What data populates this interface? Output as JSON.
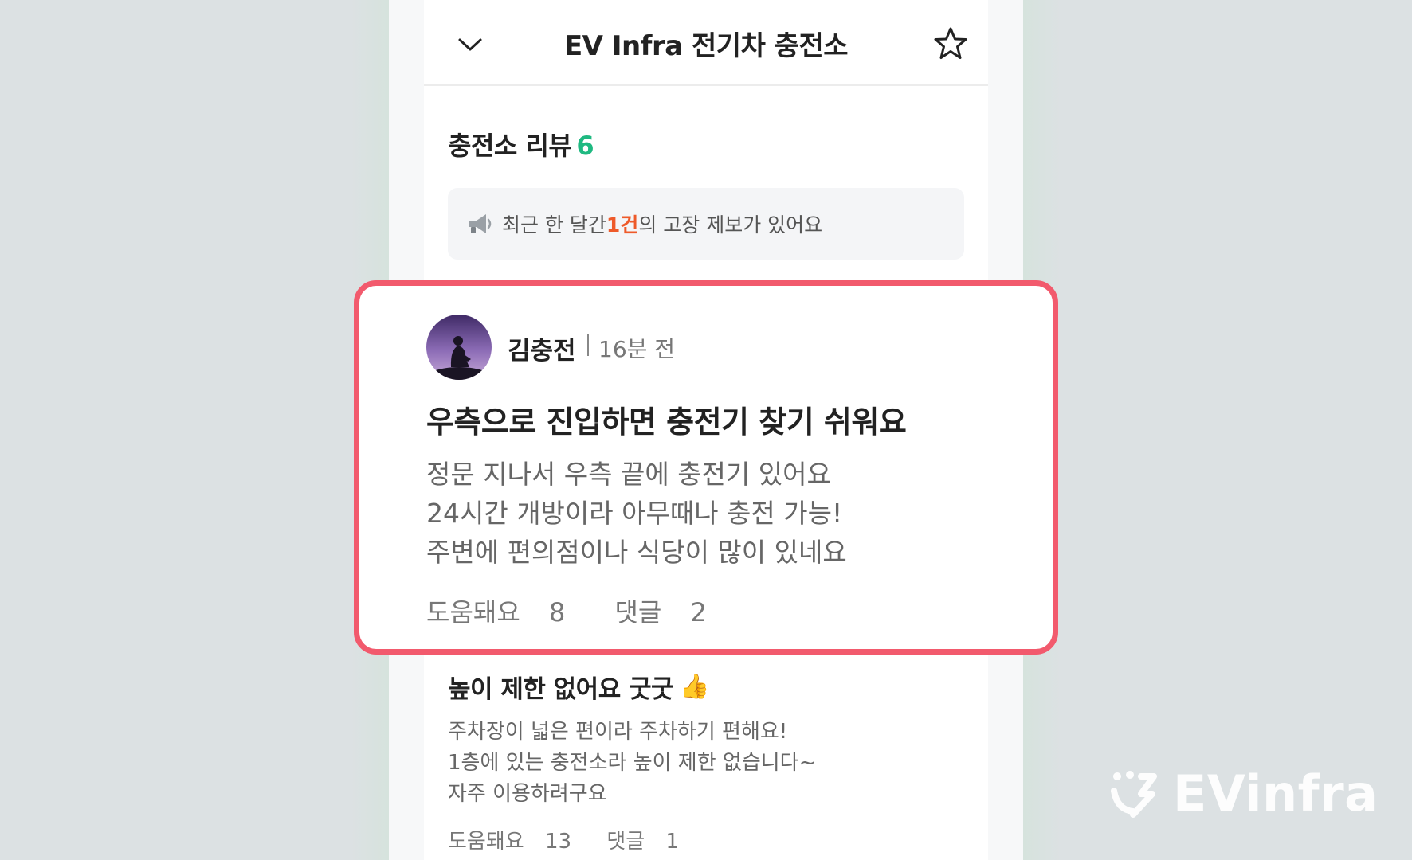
{
  "header": {
    "title": "EV Infra 전기차 충전소",
    "back_icon": "chevron-down-icon",
    "favorite_icon": "star-outline-icon"
  },
  "reviews_section": {
    "title": "충전소 리뷰",
    "count": "6"
  },
  "notice": {
    "icon": "megaphone-icon",
    "prefix": "최근 한 달간 ",
    "highlight": "1건",
    "suffix": "의 고장 제보가 있어요",
    "highlight_color": "#ee5a2a"
  },
  "featured_review": {
    "author": "김충전",
    "time": "16분 전",
    "title": "우측으로 진입하면 충전기 찾기 쉬워요",
    "body": [
      "정문 지나서 우측 끝에 충전기 있어요",
      "24시간 개방이라 아무때나 충전 가능!",
      "주변에 편의점이나 식당이 많이 있네요"
    ],
    "helpful_label": "도움돼요",
    "helpful_count": "8",
    "comment_label": "댓글",
    "comment_count": "2",
    "border_color": "#f25a6d"
  },
  "second_review": {
    "title": "높이 제한 없어요 굿굿",
    "emoji": "👍",
    "body": [
      "주차장이 넓은 편이라 주차하기 편해요!",
      "1층에 있는 충전소라 높이 제한 없습니다~",
      "자주 이용하려구요"
    ],
    "helpful_label": "도움돼요",
    "helpful_count": "13",
    "comment_label": "댓글",
    "comment_count": "1"
  },
  "watermark": {
    "text": "EVinfra"
  },
  "colors": {
    "accent_green": "#1fb981",
    "background": "#dce1e3"
  }
}
